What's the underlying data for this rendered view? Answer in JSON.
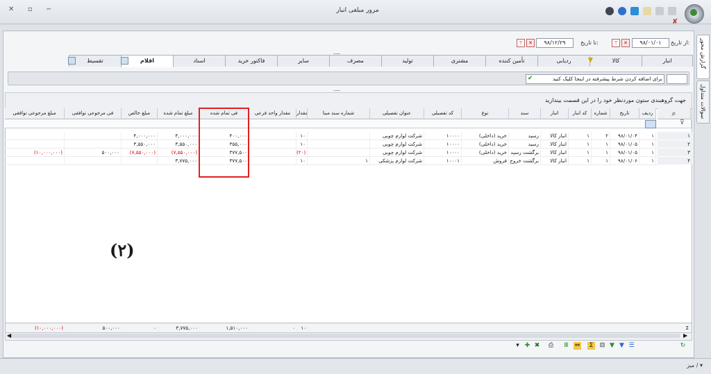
{
  "window": {
    "title": "مرور مبلغی انبار",
    "minimize_glyph": "−",
    "restore_glyph": "▫",
    "close_glyph": "✕"
  },
  "side_tabs": [
    "گزارش محور",
    "سوالات متداول"
  ],
  "dates": {
    "from_label": "از تاریخ:",
    "from_value": "۹۸/۰۱/۰۱",
    "to_label": "تا تاریخ:",
    "to_value": "۹۸/۱۲/۲۹"
  },
  "grip": "......",
  "tabs": [
    "انبار",
    "کالا",
    "ردیابی",
    "تأمین کننده",
    "مشتری",
    "تولید",
    "مصرف",
    "سایر",
    "فاکتور خرید",
    "اسناد",
    "اقلام",
    "تقسیط"
  ],
  "active_tab": "اقلام",
  "filter": {
    "hint": "برای اضافه کردن شرط پیشرفته در اینجا کلیک کنید"
  },
  "group_panel": {
    "text": "جهت گروهبندی ستون موردنظر خود را در این قسمت بیندازید"
  },
  "columns": [
    "ردیف",
    "تاریخ",
    "شماره",
    "کد انبار",
    "انبار",
    "سند",
    "نوع",
    "کد تفصیلی",
    "عنوان تفصیلی",
    "شماره سند مبنا",
    "مقدار",
    "مقدار واحد فرعی",
    "فی تمام شده",
    "مبلغ تمام شده",
    "مبلغ خالص",
    "فی مرجوعی توافقی",
    "مبلغ مرجوعی توافقی"
  ],
  "rows": [
    {
      "row": "۱",
      "date": "۹۸/۰۱/۰۴",
      "num": "۲",
      "store_code": "۱",
      "store": "انبار کالا",
      "doc": "رسید",
      "type": "خرید (داخلی)",
      "detail_code": "۱۰۰۰۰",
      "detail_title": "شرکت لوازم چوبی",
      "base_doc": "",
      "qty": "۱۰",
      "sub_qty": "",
      "unit_cost": "۴۰۰,۰۰۰",
      "total_cost": "۴,۰۰۰,۰۰۰",
      "net": "۴,۰۰۰,۰۰۰",
      "ret_unit": "",
      "ret_amount": ""
    },
    {
      "row": "۱",
      "date": "۹۸/۰۱/۰۵",
      "num": "۱",
      "store_code": "۱",
      "store": "انبار کالا",
      "doc": "رسید",
      "type": "خرید (داخلی)",
      "detail_code": "۱۰۰۰۰",
      "detail_title": "شرکت لوازم چوبی",
      "base_doc": "",
      "qty": "۱۰",
      "sub_qty": "",
      "unit_cost": "۳۵۵,۰۰۰",
      "total_cost": "۳,۵۵۰,۰۰۰",
      "net": "۳,۵۵۰,۰۰۰",
      "ret_unit": "",
      "ret_amount": ""
    },
    {
      "row": "۱",
      "date": "۹۸/۰۱/۰۵",
      "num": "۱",
      "store_code": "۱",
      "store": "انبار کالا",
      "doc": "برگشت رسید",
      "type": "خرید (داخلی)",
      "detail_code": "۱۰۰۰۰",
      "detail_title": "شرکت لوازم چوبی",
      "base_doc": "",
      "qty": "(۲۰)",
      "sub_qty": "",
      "unit_cost": "۳۷۷,۵۰۰",
      "total_cost": "(۷,۵۵۰,۰۰۰)",
      "net": "(۷,۵۵۰,۰۰۰)",
      "ret_unit": "۵۰۰,۰۰۰",
      "ret_amount": "(۱۰,۰۰۰,۰۰۰)"
    },
    {
      "row": "۱",
      "date": "۹۸/۰۱/۰۶",
      "num": "۱",
      "store_code": "۱",
      "store": "انبار کالا",
      "doc": "برگشت خروج",
      "type": "فروش",
      "detail_code": "۱۰۰۰۱",
      "detail_title": "شرکت لوازم پزشکی",
      "base_doc": "۱",
      "qty": "۱۰",
      "sub_qty": "",
      "unit_cost": "۳۷۷,۵۰۰",
      "total_cost": "۳,۷۷۵,۰۰۰",
      "net": "",
      "ret_unit": "",
      "ret_amount": ""
    }
  ],
  "row_indicators": [
    "۱",
    "۲",
    "۳",
    "۴"
  ],
  "totals": {
    "sigma": "Σ",
    "qty": "۱۰",
    "sub_qty": "۰",
    "unit_cost": "۱,۵۱۰,۰۰۰",
    "total_cost": "۳,۷۷۵,۰۰۰",
    "net": "۰",
    "ret_unit": "۵۰۰,۰۰۰",
    "ret_amount": "(۱۰,۰۰۰,۰۰۰)"
  },
  "annotation_label": "(۲)",
  "status": {
    "text": "میز / ▾"
  }
}
